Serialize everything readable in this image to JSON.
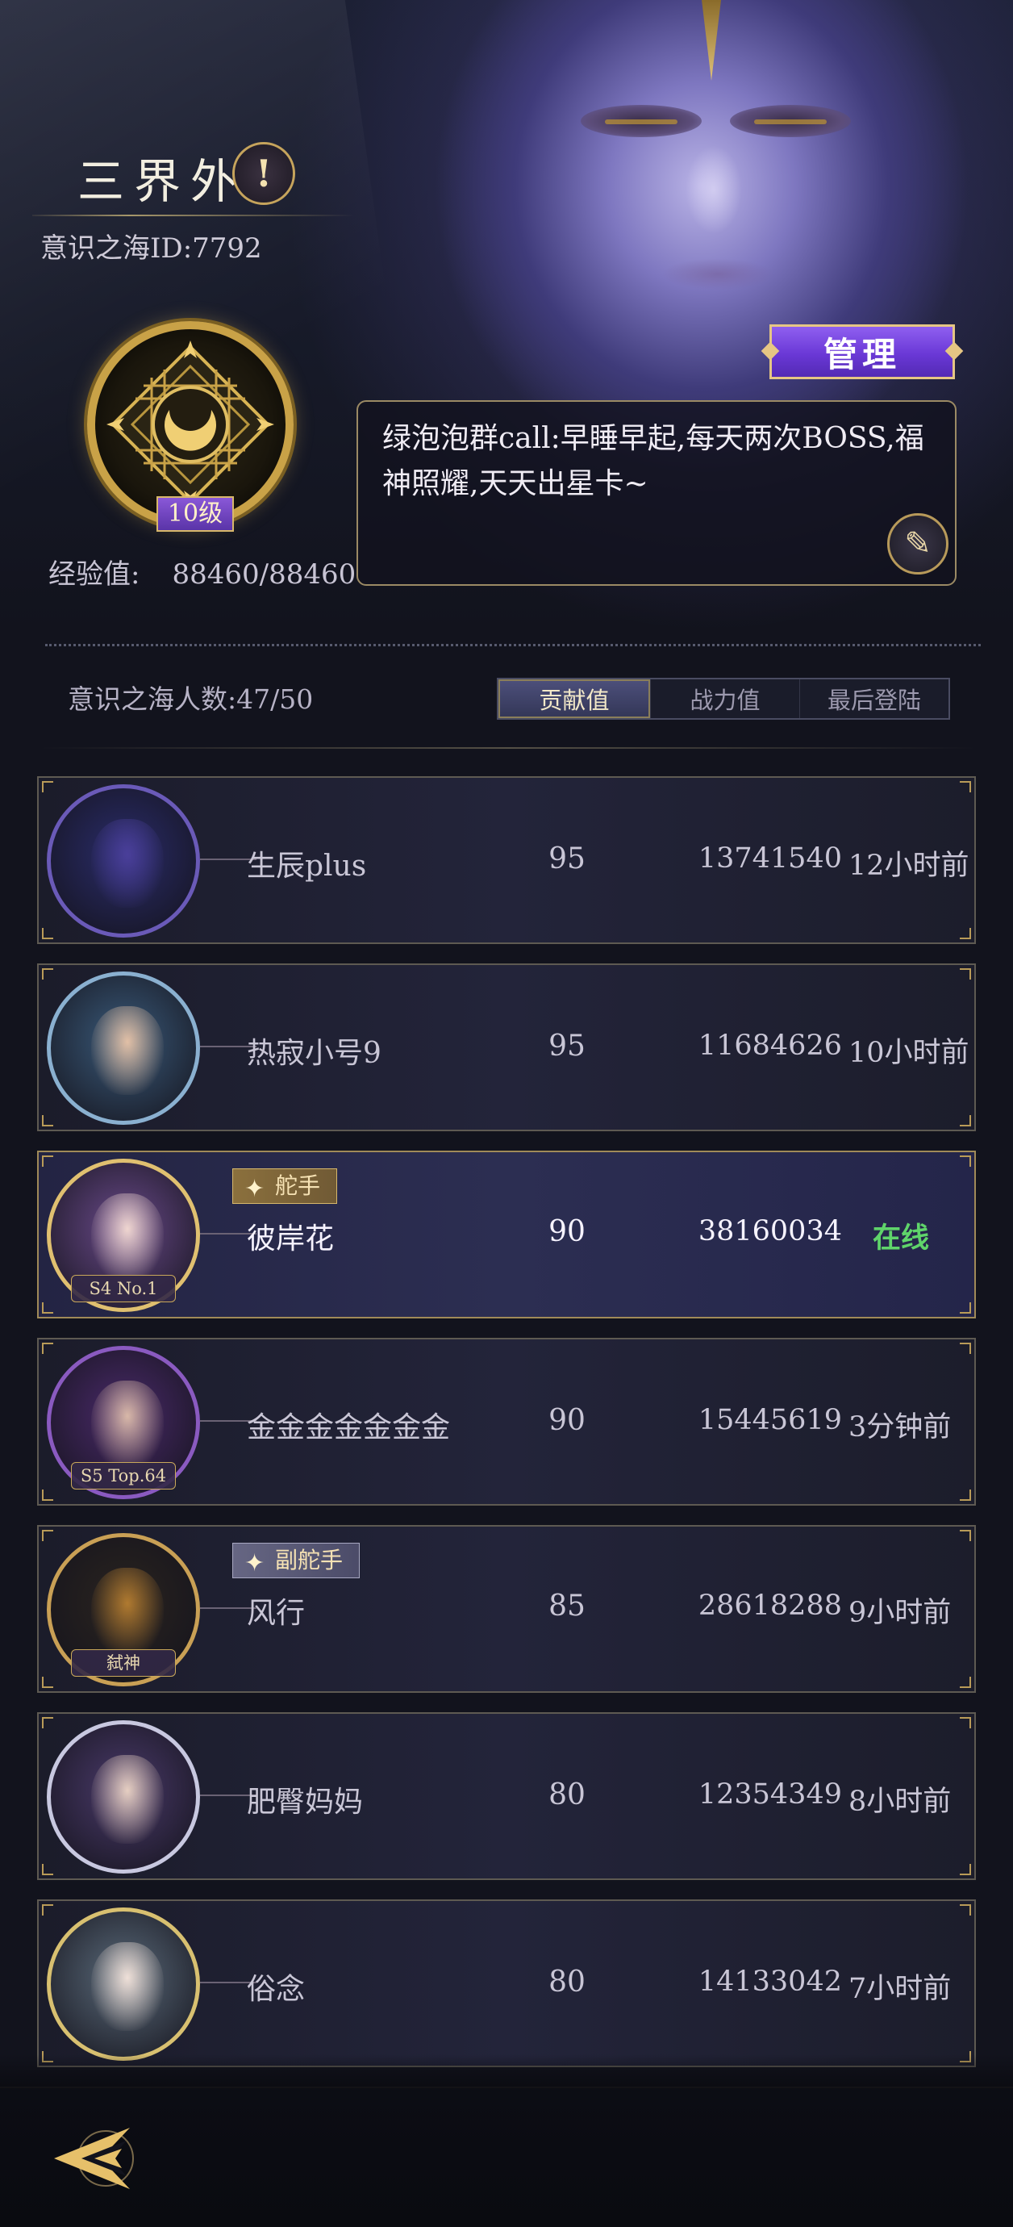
{
  "header": {
    "title": "三界外",
    "sea_id": "意识之海ID:7792",
    "info_icon": "exclamation-icon"
  },
  "guild": {
    "level": "10级",
    "exp_label": "经验值:",
    "exp_value": "88460/88460",
    "manage_label": "管理",
    "notice": "绿泡泡群call:早睡早起,每天两次BOSS,福神照耀,天天出星卡~",
    "edit_icon": "quill-pen-icon"
  },
  "members_header": {
    "count": "意识之海人数:47/50",
    "sort_tabs": [
      {
        "label": "贡献值",
        "active": true
      },
      {
        "label": "战力值",
        "active": false
      },
      {
        "label": "最后登陆",
        "active": false
      }
    ]
  },
  "members": [
    {
      "name": "生辰plus",
      "contribution": "95",
      "power": "13741540",
      "last_login": "12小时前",
      "role": "",
      "avatar_tag": "",
      "self": false,
      "colors": {
        "bg": "#2a2c6a",
        "face": "#4a3f9a",
        "ring": "#6a5ab8"
      }
    },
    {
      "name": "热寂小号9",
      "contribution": "95",
      "power": "11684626",
      "last_login": "10小时前",
      "role": "",
      "avatar_tag": "",
      "self": false,
      "colors": {
        "bg": "#3a5a7a",
        "face": "#e2c0a6",
        "ring": "#8ab0d0"
      }
    },
    {
      "name": "彼岸花",
      "contribution": "90",
      "power": "38160034",
      "last_login": "在线",
      "role": "舵手",
      "avatar_tag": "S4 No.1",
      "self": true,
      "colors": {
        "bg": "#6a4a8a",
        "face": "#efd6d0",
        "ring": "#e0c070"
      }
    },
    {
      "name": "金金金金金金金",
      "contribution": "90",
      "power": "15445619",
      "last_login": "3分钟前",
      "role": "",
      "avatar_tag": "S5 Top.64",
      "self": false,
      "colors": {
        "bg": "#4a2a6a",
        "face": "#d8b8a8",
        "ring": "#8a5ac0"
      }
    },
    {
      "name": "风行",
      "contribution": "85",
      "power": "28618288",
      "last_login": "9小时前",
      "role": "副舵手",
      "avatar_tag": "弑神",
      "self": false,
      "colors": {
        "bg": "#2a2420",
        "face": "#b07a30",
        "ring": "#c9a055"
      }
    },
    {
      "name": "肥臀妈妈",
      "contribution": "80",
      "power": "12354349",
      "last_login": "8小时前",
      "role": "",
      "avatar_tag": "",
      "self": false,
      "colors": {
        "bg": "#4a3a6a",
        "face": "#e6cfc2",
        "ring": "#c8c8e0"
      }
    },
    {
      "name": "俗念",
      "contribution": "80",
      "power": "14133042",
      "last_login": "7小时前",
      "role": "",
      "avatar_tag": "",
      "self": false,
      "colors": {
        "bg": "#5a6a7a",
        "face": "#efe0d8",
        "ring": "#d8c070"
      }
    }
  ],
  "footer": {
    "back_icon": "back-arrow-icon"
  }
}
